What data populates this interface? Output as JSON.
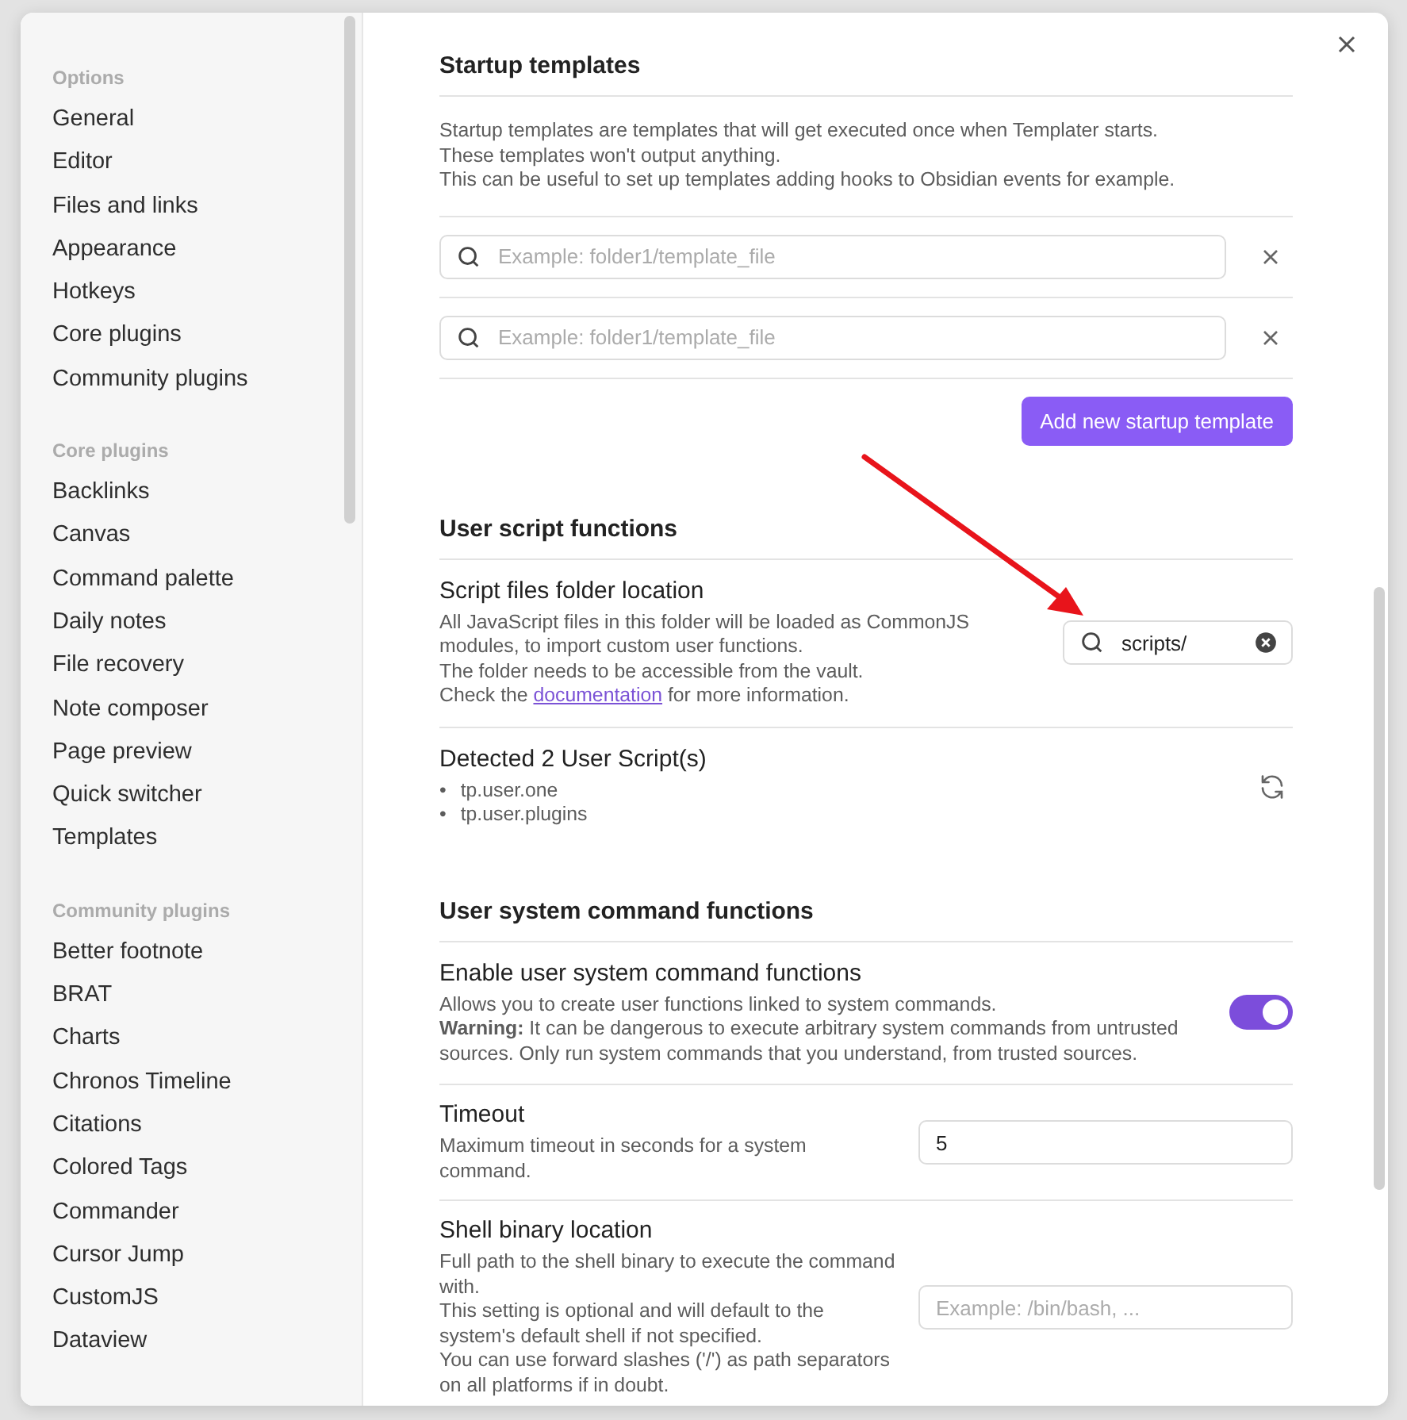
{
  "sidebar": {
    "sections": [
      {
        "heading": "Options",
        "items": [
          "General",
          "Editor",
          "Files and links",
          "Appearance",
          "Hotkeys",
          "Core plugins",
          "Community plugins"
        ]
      },
      {
        "heading": "Core plugins",
        "items": [
          "Backlinks",
          "Canvas",
          "Command palette",
          "Daily notes",
          "File recovery",
          "Note composer",
          "Page preview",
          "Quick switcher",
          "Templates"
        ]
      },
      {
        "heading": "Community plugins",
        "items": [
          "Better footnote",
          "BRAT",
          "Charts",
          "Chronos Timeline",
          "Citations",
          "Colored Tags",
          "Commander",
          "Cursor Jump",
          "CustomJS",
          "Dataview"
        ]
      }
    ]
  },
  "sections": [
    {
      "heading": "Startup templates",
      "settings": [
        {
          "kind": "info",
          "description": [
            {
              "text": "Startup templates are templates that will get executed once when Templater starts."
            },
            {
              "text": "These templates won't output anything."
            },
            {
              "text": "This can be useful to set up templates adding hooks to Obsidian events for example."
            }
          ]
        },
        {
          "kind": "template_field",
          "placeholder": "Example: folder1/template_file"
        },
        {
          "kind": "template_field",
          "placeholder": "Example: folder1/template_file"
        },
        {
          "kind": "button",
          "label": "Add new startup template"
        }
      ]
    },
    {
      "heading": "User script functions",
      "settings": [
        {
          "kind": "folder_field",
          "name": "Script files folder location",
          "value": "scripts/",
          "description": [
            {
              "text": "All JavaScript files in this folder will be loaded as CommonJS modules, to import custom user functions."
            },
            {
              "text": "The folder needs to be accessible from the vault."
            },
            {
              "text": "Check the ",
              "link": "documentation",
              "after": " for more information."
            }
          ]
        },
        {
          "kind": "script_list",
          "name": "Detected 2 User Script(s)",
          "scripts": [
            {
              "marker": "•",
              "label": "tp.user.one"
            },
            {
              "marker": "•",
              "label": "tp.user.plugins"
            }
          ]
        }
      ]
    },
    {
      "heading": "User system command functions",
      "settings": [
        {
          "kind": "toggle",
          "name": "Enable user system command functions",
          "on": true,
          "description": [
            {
              "text": "Allows you to create user functions linked to system commands."
            },
            {
              "text": "**Warning:** It can be dangerous to execute arbitrary system commands from untrusted sources. Only run system commands that you understand, from trusted sources."
            }
          ]
        },
        {
          "kind": "text_field",
          "name": "Timeout",
          "value": "5",
          "description": [
            {
              "text": "Maximum timeout in seconds for a system command."
            }
          ]
        },
        {
          "kind": "text_field",
          "name": "Shell binary location",
          "placeholder": "Example: /bin/bash, ...",
          "description": [
            {
              "text": "Full path to the shell binary to execute the command with."
            },
            {
              "text": "This setting is optional and will default to the system's default shell if not specified."
            },
            {
              "text": "You can use forward slashes ('/') as path separators on all platforms if in doubt."
            }
          ]
        }
      ]
    }
  ]
}
